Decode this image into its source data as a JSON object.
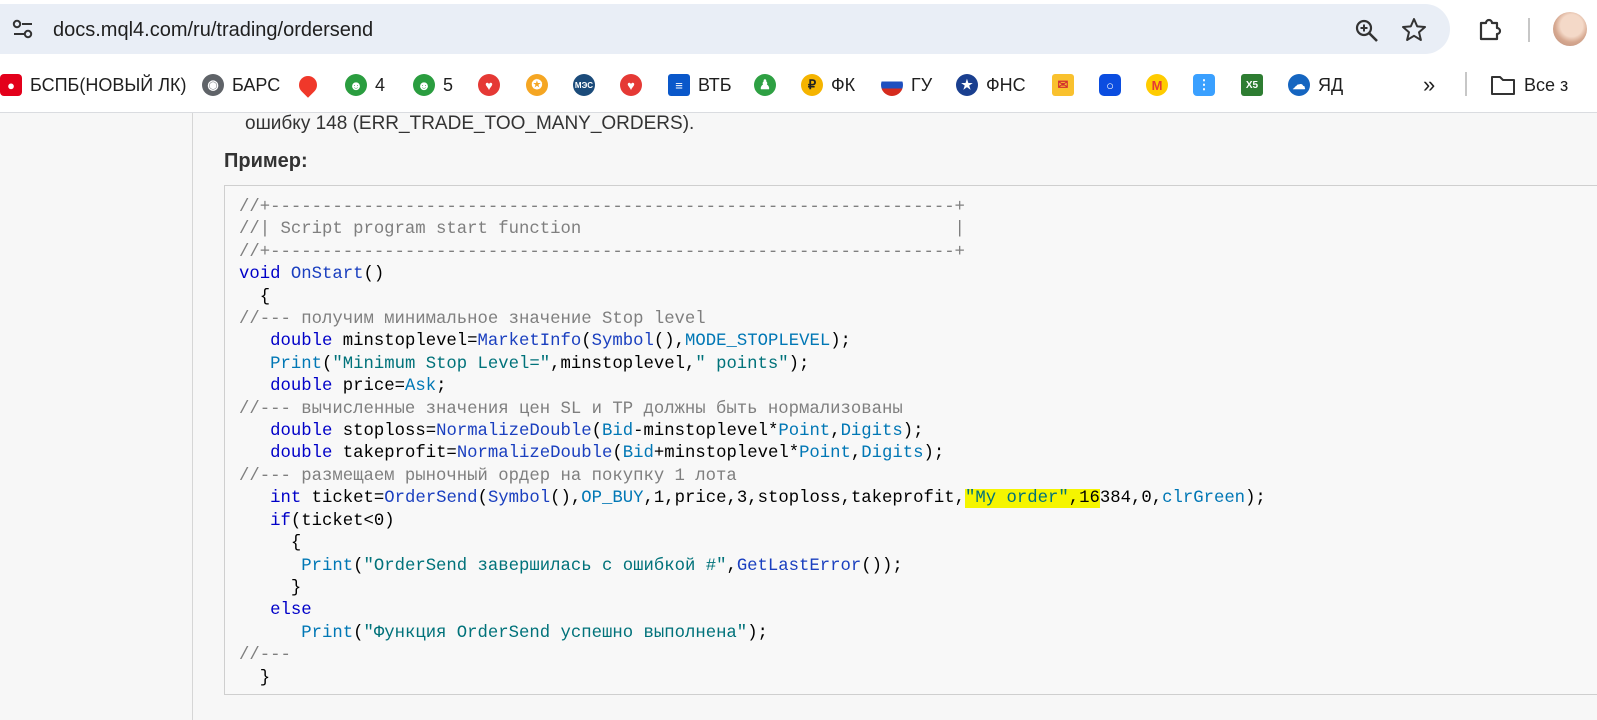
{
  "browser": {
    "url": "docs.mql4.com/ru/trading/ordersend"
  },
  "bookmarks": {
    "items": [
      {
        "label": "БСПБ(НОВЫЙ ЛК)",
        "icon": "bspb-icon",
        "color": "#e3001b"
      },
      {
        "label": "БАРС",
        "icon": "globe-icon",
        "color": "#5f6368"
      },
      {
        "label": "",
        "icon": "map-pin-icon",
        "color": "#f0382a"
      },
      {
        "label": "4",
        "icon": "people-icon",
        "color": "#2a9d3f"
      },
      {
        "label": "5",
        "icon": "people-icon",
        "color": "#2a9d3f"
      },
      {
        "label": "",
        "icon": "heart-icon",
        "color": "#e53935"
      },
      {
        "label": "",
        "icon": "sun-icon",
        "color": "#f5a623"
      },
      {
        "label": "",
        "icon": "mes-icon",
        "color": "#1b4b7a"
      },
      {
        "label": "",
        "icon": "heart-icon",
        "color": "#e53935"
      },
      {
        "label": "ВТБ",
        "icon": "vtb-icon",
        "color": "#0a58ca"
      },
      {
        "label": "",
        "icon": "person-icon",
        "color": "#2ea043"
      },
      {
        "label": "ФК",
        "icon": "ruble-icon",
        "color": "#f5b400"
      },
      {
        "label": "ГУ",
        "icon": "flag-ru-icon",
        "color": "#1e4fbf"
      },
      {
        "label": "ФНС",
        "icon": "fns-icon",
        "color": "#1a3f8f"
      },
      {
        "label": "",
        "icon": "mail-icon",
        "color": "#f9c12e"
      },
      {
        "label": "",
        "icon": "ozon-icon",
        "color": "#0b4de0"
      },
      {
        "label": "",
        "icon": "m-icon",
        "color": "#ffcc00"
      },
      {
        "label": "",
        "icon": "dots-icon",
        "color": "#3aa0ff"
      },
      {
        "label": "",
        "icon": "x5-icon",
        "color": "#2e7d32"
      },
      {
        "label": "ЯД",
        "icon": "yadisk-icon",
        "color": "#1565c0"
      }
    ],
    "more_label": "»",
    "all_label": "Все з"
  },
  "page": {
    "prev_text": "ошибку 148 (ERR_TRADE_TOO_MANY_ORDERS).",
    "example_label": "Пример:"
  },
  "code": {
    "lines": [
      "//+------------------------------------------------------------------+",
      "//| Script program start function                                    |",
      "//+------------------------------------------------------------------+",
      "void OnStart()",
      "  {",
      "//--- получим минимальное значение Stop level",
      "   double minstoplevel=MarketInfo(Symbol(),MODE_STOPLEVEL);",
      "   Print(\"Minimum Stop Level=\",minstoplevel,\" points\");",
      "   double price=Ask;",
      "//--- вычисленные значения цен SL и TP должны быть нормализованы",
      "   double stoploss=NormalizeDouble(Bid-minstoplevel*Point,Digits);",
      "   double takeprofit=NormalizeDouble(Bid+minstoplevel*Point,Digits);",
      "//--- размещаем рыночный ордер на покупку 1 лота",
      "   int ticket=OrderSend(Symbol(),OP_BUY,1,price,3,stoploss,takeprofit,\"My order\",16384,0,clrGreen);",
      "   if(ticket<0)",
      "     {",
      "      Print(\"OrderSend завершилась с ошибкой #\",GetLastError());",
      "     }",
      "   else",
      "      Print(\"Функция OrderSend успешно выполнена\");",
      "//---",
      "  }"
    ],
    "highlighted_text": "\"My order\",16"
  },
  "colors": {
    "comment": "#7f7f7f",
    "keyword": "#0000c8",
    "function": "#1a3fbf",
    "string": "#00727a",
    "highlight": "#f5f500"
  }
}
